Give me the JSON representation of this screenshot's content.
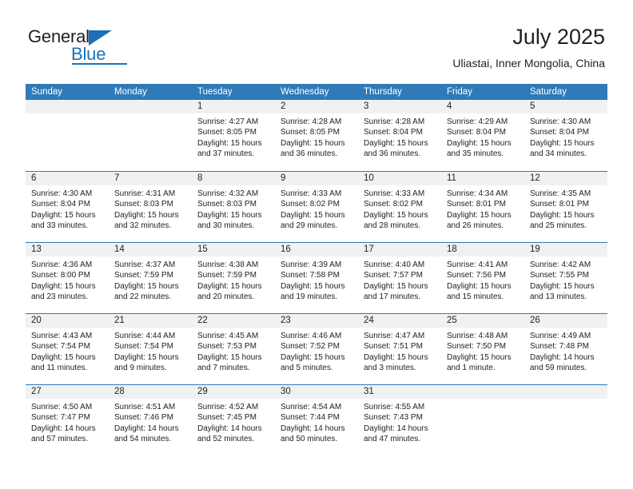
{
  "logo": {
    "word_top": "General",
    "word_bottom": "Blue",
    "triangle_color": "#1c6fb5",
    "blue_color": "#1c71b8"
  },
  "header": {
    "title": "July 2025",
    "subtitle": "Uliastai, Inner Mongolia, China"
  },
  "theme": {
    "header_bar_color": "#2f7ab8",
    "date_band_color": "#f1f1f1",
    "text_color": "#222222"
  },
  "calendar": {
    "weekdays": [
      "Sunday",
      "Monday",
      "Tuesday",
      "Wednesday",
      "Thursday",
      "Friday",
      "Saturday"
    ],
    "labels": {
      "sunrise": "Sunrise:",
      "sunset": "Sunset:",
      "daylight": "Daylight:"
    },
    "weeks": [
      [
        {
          "day": "",
          "sunrise": "",
          "sunset": "",
          "daylight_line1": "",
          "daylight_line2": ""
        },
        {
          "day": "",
          "sunrise": "",
          "sunset": "",
          "daylight_line1": "",
          "daylight_line2": ""
        },
        {
          "day": "1",
          "sunrise": "Sunrise: 4:27 AM",
          "sunset": "Sunset: 8:05 PM",
          "daylight_line1": "Daylight: 15 hours",
          "daylight_line2": "and 37 minutes."
        },
        {
          "day": "2",
          "sunrise": "Sunrise: 4:28 AM",
          "sunset": "Sunset: 8:05 PM",
          "daylight_line1": "Daylight: 15 hours",
          "daylight_line2": "and 36 minutes."
        },
        {
          "day": "3",
          "sunrise": "Sunrise: 4:28 AM",
          "sunset": "Sunset: 8:04 PM",
          "daylight_line1": "Daylight: 15 hours",
          "daylight_line2": "and 36 minutes."
        },
        {
          "day": "4",
          "sunrise": "Sunrise: 4:29 AM",
          "sunset": "Sunset: 8:04 PM",
          "daylight_line1": "Daylight: 15 hours",
          "daylight_line2": "and 35 minutes."
        },
        {
          "day": "5",
          "sunrise": "Sunrise: 4:30 AM",
          "sunset": "Sunset: 8:04 PM",
          "daylight_line1": "Daylight: 15 hours",
          "daylight_line2": "and 34 minutes."
        }
      ],
      [
        {
          "day": "6",
          "sunrise": "Sunrise: 4:30 AM",
          "sunset": "Sunset: 8:04 PM",
          "daylight_line1": "Daylight: 15 hours",
          "daylight_line2": "and 33 minutes."
        },
        {
          "day": "7",
          "sunrise": "Sunrise: 4:31 AM",
          "sunset": "Sunset: 8:03 PM",
          "daylight_line1": "Daylight: 15 hours",
          "daylight_line2": "and 32 minutes."
        },
        {
          "day": "8",
          "sunrise": "Sunrise: 4:32 AM",
          "sunset": "Sunset: 8:03 PM",
          "daylight_line1": "Daylight: 15 hours",
          "daylight_line2": "and 30 minutes."
        },
        {
          "day": "9",
          "sunrise": "Sunrise: 4:33 AM",
          "sunset": "Sunset: 8:02 PM",
          "daylight_line1": "Daylight: 15 hours",
          "daylight_line2": "and 29 minutes."
        },
        {
          "day": "10",
          "sunrise": "Sunrise: 4:33 AM",
          "sunset": "Sunset: 8:02 PM",
          "daylight_line1": "Daylight: 15 hours",
          "daylight_line2": "and 28 minutes."
        },
        {
          "day": "11",
          "sunrise": "Sunrise: 4:34 AM",
          "sunset": "Sunset: 8:01 PM",
          "daylight_line1": "Daylight: 15 hours",
          "daylight_line2": "and 26 minutes."
        },
        {
          "day": "12",
          "sunrise": "Sunrise: 4:35 AM",
          "sunset": "Sunset: 8:01 PM",
          "daylight_line1": "Daylight: 15 hours",
          "daylight_line2": "and 25 minutes."
        }
      ],
      [
        {
          "day": "13",
          "sunrise": "Sunrise: 4:36 AM",
          "sunset": "Sunset: 8:00 PM",
          "daylight_line1": "Daylight: 15 hours",
          "daylight_line2": "and 23 minutes."
        },
        {
          "day": "14",
          "sunrise": "Sunrise: 4:37 AM",
          "sunset": "Sunset: 7:59 PM",
          "daylight_line1": "Daylight: 15 hours",
          "daylight_line2": "and 22 minutes."
        },
        {
          "day": "15",
          "sunrise": "Sunrise: 4:38 AM",
          "sunset": "Sunset: 7:59 PM",
          "daylight_line1": "Daylight: 15 hours",
          "daylight_line2": "and 20 minutes."
        },
        {
          "day": "16",
          "sunrise": "Sunrise: 4:39 AM",
          "sunset": "Sunset: 7:58 PM",
          "daylight_line1": "Daylight: 15 hours",
          "daylight_line2": "and 19 minutes."
        },
        {
          "day": "17",
          "sunrise": "Sunrise: 4:40 AM",
          "sunset": "Sunset: 7:57 PM",
          "daylight_line1": "Daylight: 15 hours",
          "daylight_line2": "and 17 minutes."
        },
        {
          "day": "18",
          "sunrise": "Sunrise: 4:41 AM",
          "sunset": "Sunset: 7:56 PM",
          "daylight_line1": "Daylight: 15 hours",
          "daylight_line2": "and 15 minutes."
        },
        {
          "day": "19",
          "sunrise": "Sunrise: 4:42 AM",
          "sunset": "Sunset: 7:55 PM",
          "daylight_line1": "Daylight: 15 hours",
          "daylight_line2": "and 13 minutes."
        }
      ],
      [
        {
          "day": "20",
          "sunrise": "Sunrise: 4:43 AM",
          "sunset": "Sunset: 7:54 PM",
          "daylight_line1": "Daylight: 15 hours",
          "daylight_line2": "and 11 minutes."
        },
        {
          "day": "21",
          "sunrise": "Sunrise: 4:44 AM",
          "sunset": "Sunset: 7:54 PM",
          "daylight_line1": "Daylight: 15 hours",
          "daylight_line2": "and 9 minutes."
        },
        {
          "day": "22",
          "sunrise": "Sunrise: 4:45 AM",
          "sunset": "Sunset: 7:53 PM",
          "daylight_line1": "Daylight: 15 hours",
          "daylight_line2": "and 7 minutes."
        },
        {
          "day": "23",
          "sunrise": "Sunrise: 4:46 AM",
          "sunset": "Sunset: 7:52 PM",
          "daylight_line1": "Daylight: 15 hours",
          "daylight_line2": "and 5 minutes."
        },
        {
          "day": "24",
          "sunrise": "Sunrise: 4:47 AM",
          "sunset": "Sunset: 7:51 PM",
          "daylight_line1": "Daylight: 15 hours",
          "daylight_line2": "and 3 minutes."
        },
        {
          "day": "25",
          "sunrise": "Sunrise: 4:48 AM",
          "sunset": "Sunset: 7:50 PM",
          "daylight_line1": "Daylight: 15 hours",
          "daylight_line2": "and 1 minute."
        },
        {
          "day": "26",
          "sunrise": "Sunrise: 4:49 AM",
          "sunset": "Sunset: 7:48 PM",
          "daylight_line1": "Daylight: 14 hours",
          "daylight_line2": "and 59 minutes."
        }
      ],
      [
        {
          "day": "27",
          "sunrise": "Sunrise: 4:50 AM",
          "sunset": "Sunset: 7:47 PM",
          "daylight_line1": "Daylight: 14 hours",
          "daylight_line2": "and 57 minutes."
        },
        {
          "day": "28",
          "sunrise": "Sunrise: 4:51 AM",
          "sunset": "Sunset: 7:46 PM",
          "daylight_line1": "Daylight: 14 hours",
          "daylight_line2": "and 54 minutes."
        },
        {
          "day": "29",
          "sunrise": "Sunrise: 4:52 AM",
          "sunset": "Sunset: 7:45 PM",
          "daylight_line1": "Daylight: 14 hours",
          "daylight_line2": "and 52 minutes."
        },
        {
          "day": "30",
          "sunrise": "Sunrise: 4:54 AM",
          "sunset": "Sunset: 7:44 PM",
          "daylight_line1": "Daylight: 14 hours",
          "daylight_line2": "and 50 minutes."
        },
        {
          "day": "31",
          "sunrise": "Sunrise: 4:55 AM",
          "sunset": "Sunset: 7:43 PM",
          "daylight_line1": "Daylight: 14 hours",
          "daylight_line2": "and 47 minutes."
        },
        {
          "day": "",
          "sunrise": "",
          "sunset": "",
          "daylight_line1": "",
          "daylight_line2": ""
        },
        {
          "day": "",
          "sunrise": "",
          "sunset": "",
          "daylight_line1": "",
          "daylight_line2": ""
        }
      ]
    ]
  }
}
